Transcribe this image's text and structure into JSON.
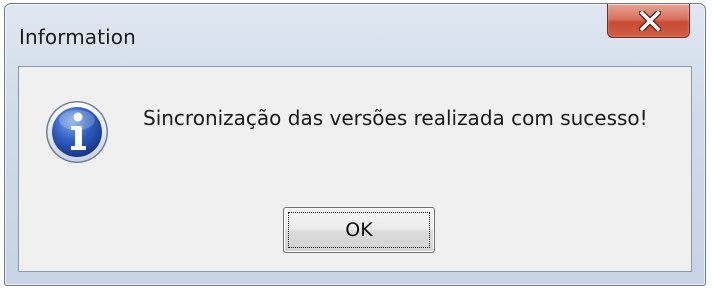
{
  "dialog": {
    "title": "Information",
    "message": "Sincronização das versões realizada com sucesso!",
    "ok_label": "OK",
    "icon": "information-icon",
    "close_icon": "close-icon"
  },
  "colors": {
    "frame": "#cfdbe8",
    "close_button": "#c94a32",
    "client_background": "#f0f0f0",
    "icon_blue": "#2a58b8"
  }
}
